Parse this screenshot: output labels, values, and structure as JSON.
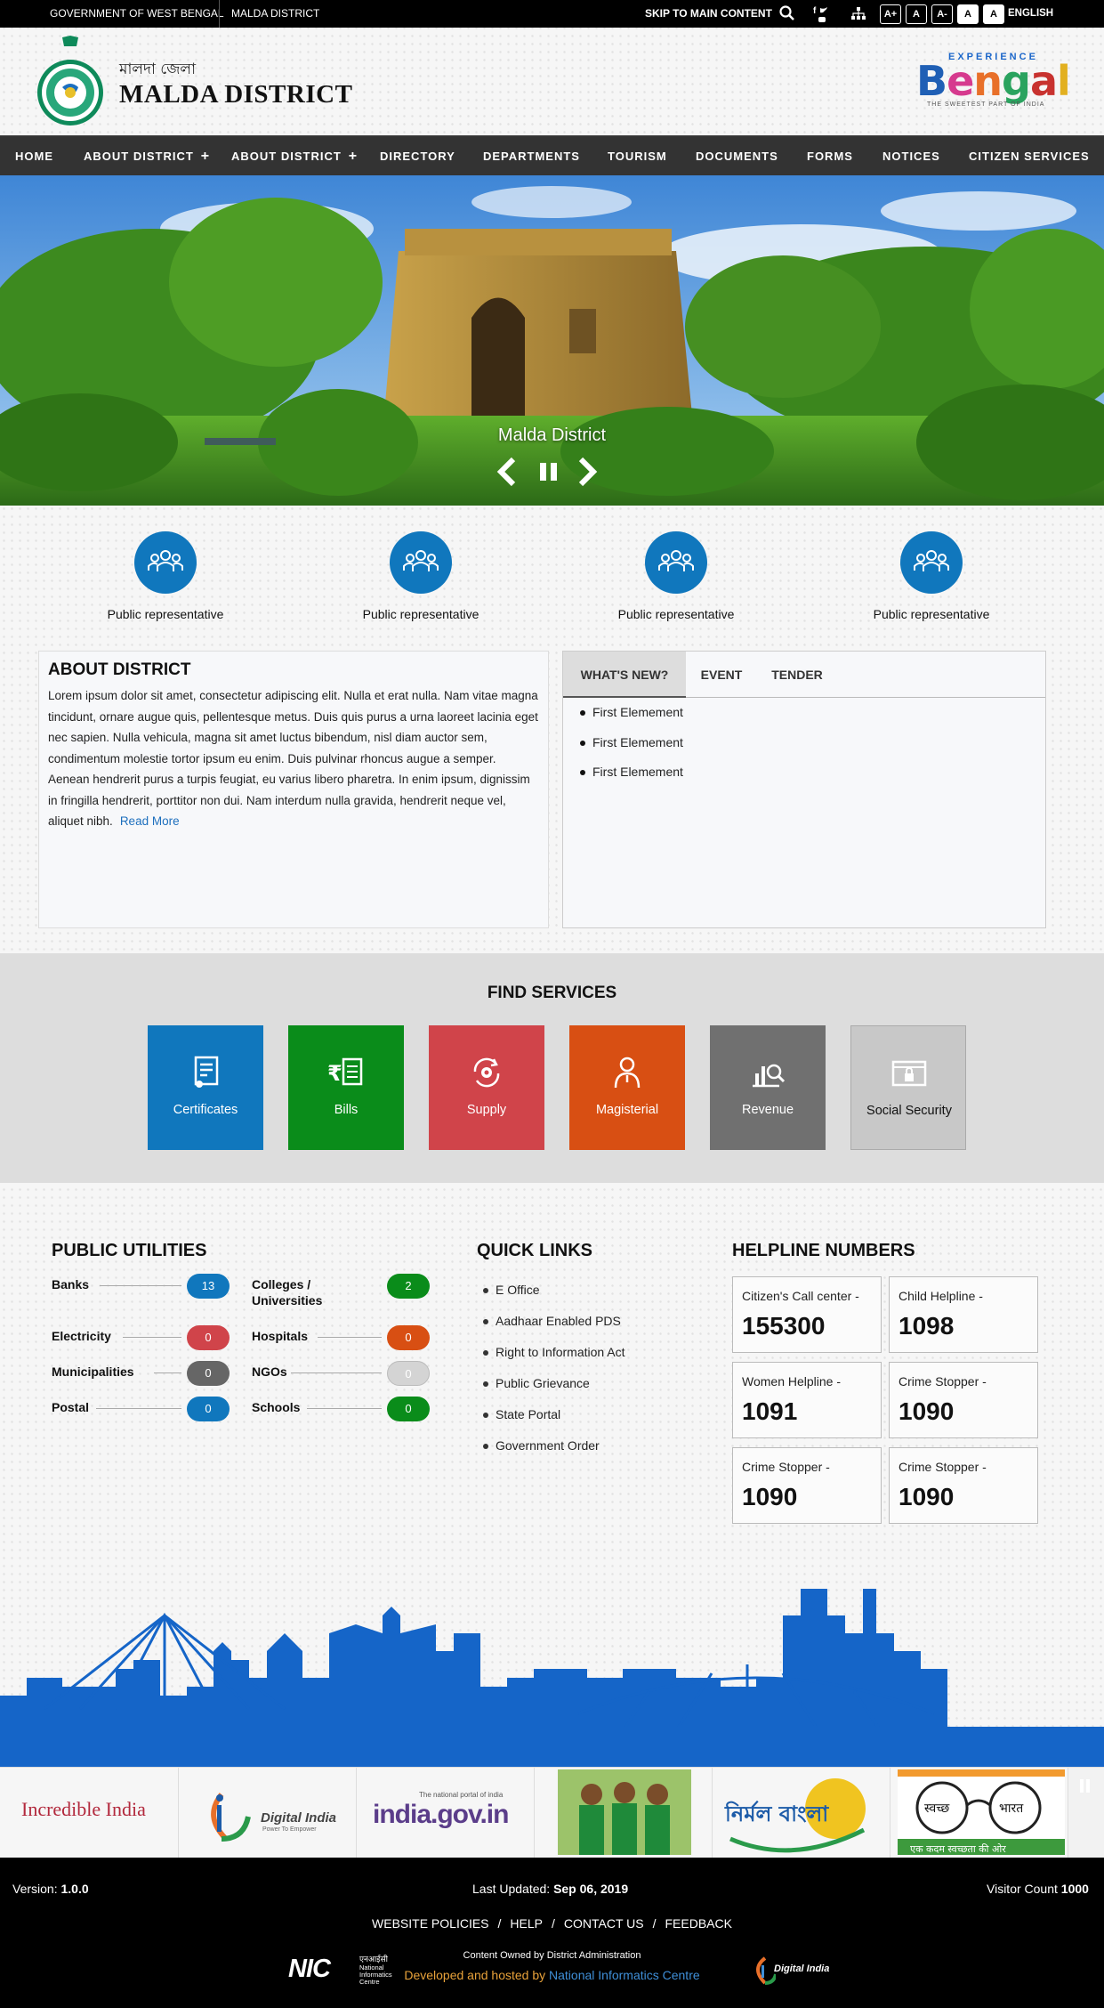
{
  "topbar": {
    "gov_link": "GOVERNMENT OF WEST BENGAL",
    "district_link": "MALDA DISTRICT",
    "skip": "SKIP TO MAIN CONTENT",
    "font_buttons": [
      "A+",
      "A",
      "A-",
      "A",
      "A"
    ],
    "language": "ENGLISH"
  },
  "header": {
    "bengali_title": "মালদা জেলা",
    "title": "MALDA DISTRICT",
    "bengal_logo": {
      "top": "EXPERIENCE",
      "word": "Bengal",
      "tagline": "THE SWEETEST PART OF INDIA"
    }
  },
  "nav": {
    "items": [
      {
        "label": "HOME"
      },
      {
        "label": "ABOUT DISTRICT",
        "has_sub": "+"
      },
      {
        "label": "ABOUT DISTRICT",
        "has_sub": "+"
      },
      {
        "label": "DIRECTORY"
      },
      {
        "label": "DEPARTMENTS"
      },
      {
        "label": "TOURISM"
      },
      {
        "label": "DOCUMENTS"
      },
      {
        "label": "FORMS"
      },
      {
        "label": "NOTICES"
      },
      {
        "label": "CITIZEN SERVICES"
      }
    ]
  },
  "hero": {
    "caption": "Malda District"
  },
  "representatives": [
    {
      "label": "Public representative"
    },
    {
      "label": "Public representative"
    },
    {
      "label": "Public representative"
    },
    {
      "label": "Public representative"
    }
  ],
  "about": {
    "title": "ABOUT DISTRICT",
    "text": "Lorem ipsum dolor sit amet, consectetur adipiscing elit. Nulla et erat nulla. Nam vitae magna tincidunt, ornare augue quis, pellentesque metus. Duis quis purus a urna laoreet lacinia eget nec sapien. Nulla vehicula, magna sit amet luctus bibendum, nisl diam auctor sem, condimentum molestie tortor ipsum eu enim. Duis pulvinar rhoncus augue a semper. Aenean hendrerit purus a turpis feugiat, eu varius libero pharetra. In enim ipsum, dignissim in fringilla hendrerit, porttitor non dui. Nam interdum nulla gravida, hendrerit neque vel, aliquet nibh.",
    "read_more": "Read More"
  },
  "news": {
    "tabs": [
      "WHAT'S NEW?",
      "EVENT",
      "TENDER"
    ],
    "items": [
      "First Elemement",
      "First Elemement",
      "First Elemement"
    ]
  },
  "services": {
    "title": "FIND SERVICES",
    "items": [
      {
        "label": "Certificates",
        "color": "#1077bd"
      },
      {
        "label": "Bills",
        "color": "#0a8c1a"
      },
      {
        "label": "Supply",
        "color": "#d0444a"
      },
      {
        "label": "Magisterial",
        "color": "#d84f13"
      },
      {
        "label": "Revenue",
        "color": "#707070"
      },
      {
        "label": "Social Security",
        "color": "#c8c8c8"
      }
    ]
  },
  "utilities": {
    "title": "PUBLIC UTILITIES",
    "items": [
      {
        "name": "Banks",
        "count": "13",
        "color": "#1077bd"
      },
      {
        "name": "Colleges / Universities",
        "count": "2",
        "color": "#0a8c1a"
      },
      {
        "name": "Electricity",
        "count": "0",
        "color": "#d0444a"
      },
      {
        "name": "Hospitals",
        "count": "0",
        "color": "#d84f13"
      },
      {
        "name": "Municipalities",
        "count": "0",
        "color": "#666666"
      },
      {
        "name": "NGOs",
        "count": "0",
        "color": "#cccccc"
      },
      {
        "name": "Postal",
        "count": "0",
        "color": "#1077bd"
      },
      {
        "name": "Schools",
        "count": "0",
        "color": "#0a8c1a"
      }
    ]
  },
  "quick_links": {
    "title": "QUICK LINKS",
    "items": [
      "E Office",
      "Aadhaar Enabled PDS",
      "Right to Information Act",
      "Public Grievance",
      "State Portal",
      "Government Order"
    ]
  },
  "helplines": {
    "title": "HELPLINE NUMBERS",
    "items": [
      {
        "label": "Citizen's Call center -",
        "number": "155300"
      },
      {
        "label": "Child Helpline -",
        "number": "1098"
      },
      {
        "label": "Women Helpline -",
        "number": "1091"
      },
      {
        "label": "Crime Stopper -",
        "number": "1090"
      },
      {
        "label": "Crime Stopper -",
        "number": "1090"
      },
      {
        "label": "Crime Stopper -",
        "number": "1090"
      }
    ]
  },
  "partner_logos": {
    "incredible_india": "Incredible India",
    "digital_india": "Digital India",
    "digital_india_tag": "Power To Empower",
    "india_gov_tag": "The national portal of india",
    "india_gov": "india.gov.in",
    "nirmal_bangla": "নির্মল বাংলা",
    "swachh_1": "स्वच्छ",
    "swachh_2": "भारत",
    "swachh_tag": "एक कदम स्वच्छता की ओर"
  },
  "footer": {
    "version_label": "Version:",
    "version": "1.0.0",
    "updated_label": "Last Updated:",
    "updated": "Sep 06, 2019",
    "visitor_label": "Visitor Count",
    "visitor": "1000",
    "links": [
      "WEBSITE POLICIES",
      "HELP",
      "CONTACT US",
      "FEEDBACK"
    ],
    "owned": "Content Owned by District Administration",
    "hosted_prefix": "Developed and hosted by",
    "hosted_org": "National Informatics Centre",
    "nic_logo": "NIC",
    "nic_hindi": "एनआईसी",
    "nic_full": "National Informatics Centre",
    "digital_india": "Digital India"
  },
  "colors": {
    "primary": "#1077bd",
    "nav_bg": "#333333",
    "skyline": "#1565c8"
  }
}
